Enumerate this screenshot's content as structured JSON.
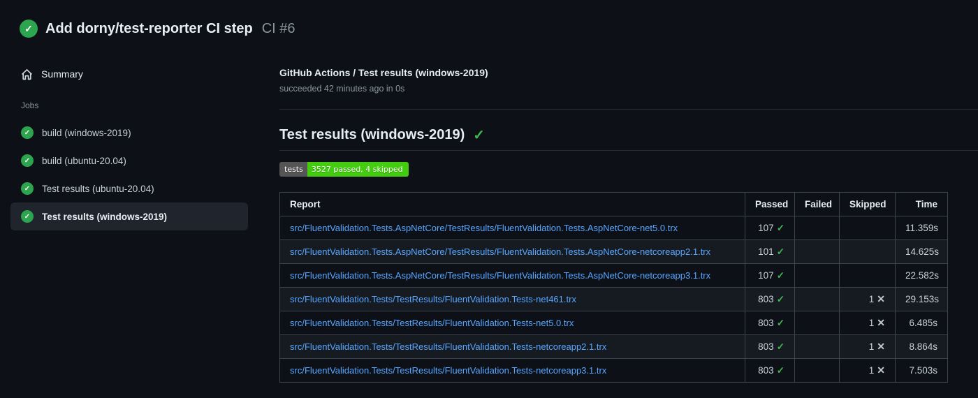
{
  "header": {
    "title": "Add dorny/test-reporter CI step",
    "run_number": "CI #6",
    "status": "success"
  },
  "sidebar": {
    "summary_label": "Summary",
    "jobs_label": "Jobs",
    "jobs": [
      {
        "label": "build (windows-2019)",
        "status": "success",
        "selected": false
      },
      {
        "label": "build (ubuntu-20.04)",
        "status": "success",
        "selected": false
      },
      {
        "label": "Test results (ubuntu-20.04)",
        "status": "success",
        "selected": false
      },
      {
        "label": "Test results (windows-2019)",
        "status": "success",
        "selected": true
      }
    ]
  },
  "main": {
    "run_title": "GitHub Actions / Test results (windows-2019)",
    "run_status": "succeeded 42 minutes ago in 0s",
    "section_title": "Test results (windows-2019)",
    "badge": {
      "label": "tests",
      "value": "3527 passed, 4 skipped",
      "label_bg": "#555555",
      "value_bg": "#44cc11"
    },
    "table": {
      "headers": [
        "Report",
        "Passed",
        "Failed",
        "Skipped",
        "Time"
      ],
      "rows": [
        {
          "report": "src/FluentValidation.Tests.AspNetCore/TestResults/FluentValidation.Tests.AspNetCore-net5.0.trx",
          "passed": "107",
          "failed": "",
          "skipped": "",
          "time": "11.359s"
        },
        {
          "report": "src/FluentValidation.Tests.AspNetCore/TestResults/FluentValidation.Tests.AspNetCore-netcoreapp2.1.trx",
          "passed": "101",
          "failed": "",
          "skipped": "",
          "time": "14.625s"
        },
        {
          "report": "src/FluentValidation.Tests.AspNetCore/TestResults/FluentValidation.Tests.AspNetCore-netcoreapp3.1.trx",
          "passed": "107",
          "failed": "",
          "skipped": "",
          "time": "22.582s"
        },
        {
          "report": "src/FluentValidation.Tests/TestResults/FluentValidation.Tests-net461.trx",
          "passed": "803",
          "failed": "",
          "skipped": "1",
          "time": "29.153s"
        },
        {
          "report": "src/FluentValidation.Tests/TestResults/FluentValidation.Tests-net5.0.trx",
          "passed": "803",
          "failed": "",
          "skipped": "1",
          "time": "6.485s"
        },
        {
          "report": "src/FluentValidation.Tests/TestResults/FluentValidation.Tests-netcoreapp2.1.trx",
          "passed": "803",
          "failed": "",
          "skipped": "1",
          "time": "8.864s"
        },
        {
          "report": "src/FluentValidation.Tests/TestResults/FluentValidation.Tests-netcoreapp3.1.trx",
          "passed": "803",
          "failed": "",
          "skipped": "1",
          "time": "7.503s"
        }
      ]
    }
  },
  "icons": {
    "check_glyph": "✓",
    "cross_glyph": "✕"
  },
  "colors": {
    "page_bg": "#0d1117",
    "row_alt_bg": "#161b22",
    "success_green": "#2da44e",
    "check_green": "#3fb950",
    "link_blue": "#58a6ff",
    "muted_text": "#8b949e",
    "table_border": "#3d444d"
  }
}
